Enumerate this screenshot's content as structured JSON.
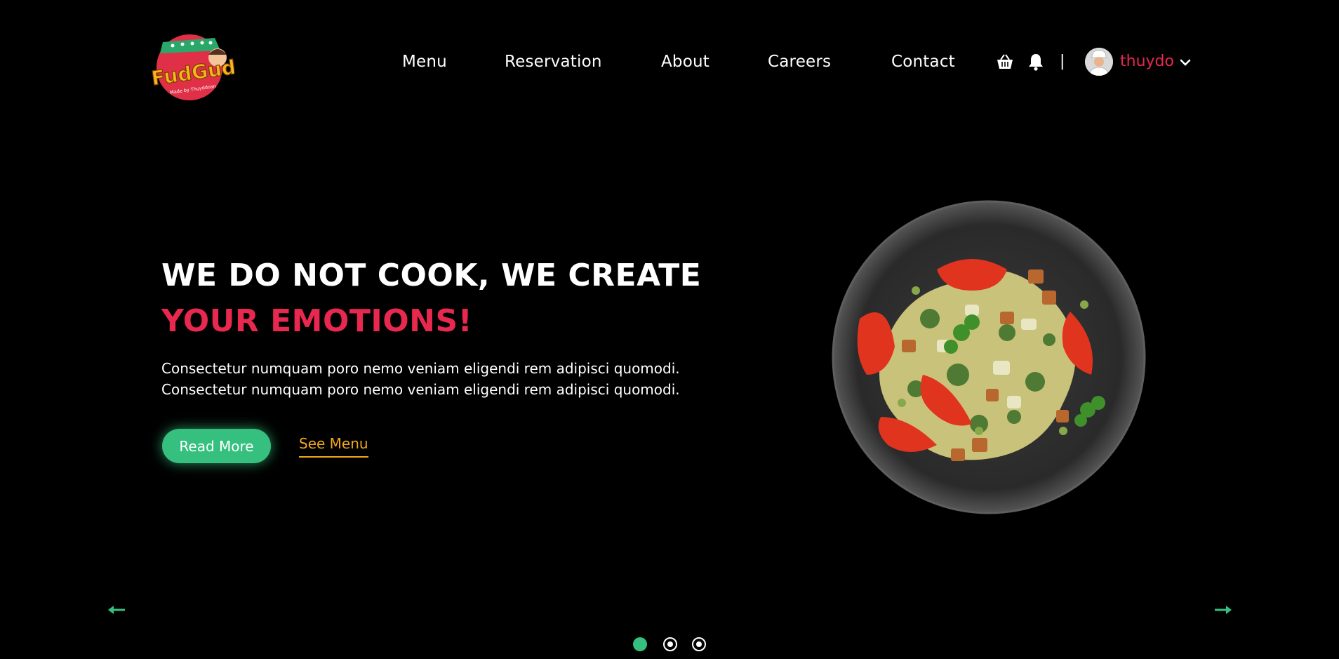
{
  "brand": {
    "logo_text": "FudGud",
    "logo_subtitle": "Made by Thuyddoan"
  },
  "nav": {
    "items": [
      {
        "label": "Menu"
      },
      {
        "label": "Reservation"
      },
      {
        "label": "About"
      },
      {
        "label": "Careers"
      },
      {
        "label": "Contact"
      }
    ],
    "divider": "|",
    "user": {
      "name": "thuydo"
    }
  },
  "icons": {
    "cart": "basket-icon",
    "notifications": "bell-icon",
    "dropdown": "chevron-down-icon",
    "prev": "arrow-left-icon",
    "next": "arrow-right-icon"
  },
  "hero": {
    "headline_white": "WE DO NOT COOK, WE CREATE ",
    "headline_highlight": "YOUR EMOTIONS!",
    "description_line1": "Consectetur numquam poro nemo veniam eligendi rem adipisci quomodi.",
    "description_line2": "Consectetur numquam poro nemo veniam eligendi rem adipisci quomodi.",
    "primary_button": "Read More",
    "secondary_link": "See Menu"
  },
  "carousel": {
    "slides": 3,
    "active_index": 0
  },
  "colors": {
    "background": "#000000",
    "accent_red": "#e8284f",
    "accent_green": "#35c07f",
    "accent_yellow": "#f2a81d",
    "text": "#ffffff"
  }
}
